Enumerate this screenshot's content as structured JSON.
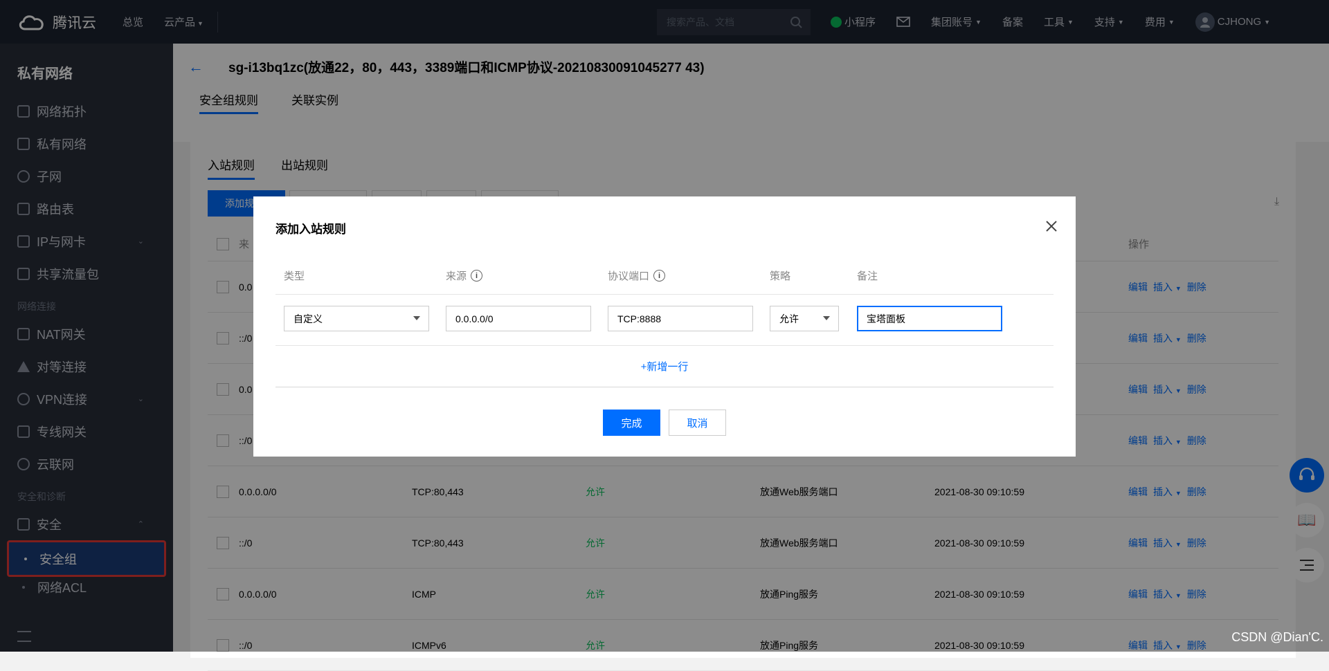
{
  "topbar": {
    "brand": "腾讯云",
    "nav": [
      "总览",
      "云产品"
    ],
    "search_placeholder": "搜索产品、文档",
    "right": [
      "小程序",
      "集团账号",
      "备案",
      "工具",
      "支持",
      "费用"
    ],
    "user": "CJHONG"
  },
  "sidebar": {
    "title": "私有网络",
    "items": [
      "网络拓扑",
      "私有网络",
      "子网",
      "路由表",
      "IP与网卡",
      "共享流量包"
    ],
    "group1": "网络连接",
    "items2": [
      "NAT网关",
      "对等连接",
      "VPN连接",
      "专线网关",
      "云联网"
    ],
    "group2": "安全和诊断",
    "security": "安全",
    "sub": [
      "安全组",
      "网络ACL"
    ]
  },
  "header": {
    "title": "sg-i13bq1zc(放通22，80，443，3389端口和ICMP协议-20210830091045277 43)",
    "tabs": [
      "安全组规则",
      "关联实例"
    ]
  },
  "panel": {
    "tabs": [
      "入站规则",
      "出站规则"
    ],
    "add_button": "添加规",
    "columns": [
      "来",
      "操作"
    ],
    "rows": [
      {
        "src": "0.0",
        "port": "",
        "policy": "",
        "note": "",
        "time": ""
      },
      {
        "src": "::/0",
        "port": "",
        "policy": "",
        "note": "",
        "time": ""
      },
      {
        "src": "0.0",
        "port": "",
        "policy": "",
        "note": "",
        "time": ""
      },
      {
        "src": "::/0",
        "port": "",
        "policy": "",
        "note": "",
        "time": ""
      },
      {
        "src": "0.0.0.0/0",
        "port": "TCP:80,443",
        "policy": "允许",
        "note": "放通Web服务端口",
        "time": "2021-08-30 09:10:59"
      },
      {
        "src": "::/0",
        "port": "TCP:80,443",
        "policy": "允许",
        "note": "放通Web服务端口",
        "time": "2021-08-30 09:10:59"
      },
      {
        "src": "0.0.0.0/0",
        "port": "ICMP",
        "policy": "允许",
        "note": "放通Ping服务",
        "time": "2021-08-30 09:10:59"
      },
      {
        "src": "::/0",
        "port": "ICMPv6",
        "policy": "允许",
        "note": "放通Ping服务",
        "time": "2021-08-30 09:10:59"
      }
    ],
    "ops": {
      "edit": "编辑",
      "insert": "插入",
      "delete": "删除"
    }
  },
  "modal": {
    "title": "添加入站规则",
    "headers": {
      "type": "类型",
      "source": "来源",
      "port": "协议端口",
      "policy": "策略",
      "note": "备注"
    },
    "row": {
      "type": "自定义",
      "source": "0.0.0.0/0",
      "port": "TCP:8888",
      "policy": "允许",
      "note": "宝塔面板"
    },
    "add_row": "+新增一行",
    "ok": "完成",
    "cancel": "取消"
  },
  "watermark": "CSDN @Dian'C.",
  "colors": {
    "primary": "#006eff",
    "allow": "#0abf5b",
    "topbar": "#1d2330",
    "sidebar": "#282e3a"
  }
}
